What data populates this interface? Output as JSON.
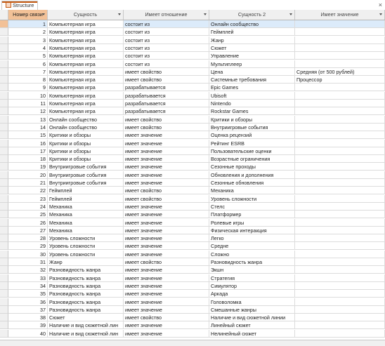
{
  "tab": {
    "title": "Structure",
    "close": "×"
  },
  "columns": [
    {
      "label": "Номер связи",
      "selected": true
    },
    {
      "label": "Сущность"
    },
    {
      "label": "Имеет отношение"
    },
    {
      "label": "Сущность 2"
    },
    {
      "label": "Имеет значение"
    }
  ],
  "rows": [
    [
      "1",
      "Компьютерная игра",
      "состоит из",
      "Онлайн сообщество",
      ""
    ],
    [
      "2",
      "Компьютерная игра",
      "состоит из",
      "Геймплей",
      ""
    ],
    [
      "3",
      "Компьютерная игра",
      "состоит из",
      "Жанр",
      ""
    ],
    [
      "4",
      "Компьютерная игра",
      "состоит из",
      "Сюжет",
      ""
    ],
    [
      "5",
      "Компьютерная игра",
      "состоит из",
      "Управление",
      ""
    ],
    [
      "6",
      "Компьютерная игра",
      "состоит из",
      "Мультиплеер",
      ""
    ],
    [
      "7",
      "Компьютерная игра",
      "имеет свойство",
      "Цена",
      "Средняя (от 500 рублей)"
    ],
    [
      "8",
      "Компьютерная игра",
      "имеет свойство",
      "Системные требования",
      "Процессор"
    ],
    [
      "9",
      "Компьютерная игра",
      "разрабатывается",
      "Epic Games",
      ""
    ],
    [
      "10",
      "Компьютерная игра",
      "разрабатывается",
      "Ubisoft",
      ""
    ],
    [
      "11",
      "Компьютерная игра",
      "разрабатывается",
      "Nintendo",
      ""
    ],
    [
      "12",
      "Компьютерная игра",
      "разрабатывается",
      "Rockstar Games",
      ""
    ],
    [
      "13",
      "Онлайн сообщество",
      "имеет свойство",
      "Критики и обзоры",
      ""
    ],
    [
      "14",
      "Онлайн сообщество",
      "имеет свойство",
      "Внутриигровые события",
      ""
    ],
    [
      "15",
      "Критики и обзоры",
      "имеет значение",
      "Оценка рецензий",
      ""
    ],
    [
      "16",
      "Критики и обзоры",
      "имеет значение",
      "Рейтинг ESRB",
      ""
    ],
    [
      "17",
      "Критики и обзоры",
      "имеет значение",
      "Пользовательские оценки",
      ""
    ],
    [
      "18",
      "Критики и обзоры",
      "имеет значение",
      "Возрастные ограничения",
      ""
    ],
    [
      "19",
      "Внутриигровые события",
      "имеет значение",
      "Сезонные проходы",
      ""
    ],
    [
      "20",
      "Внутриигровые события",
      "имеет значение",
      "Обновления и дополнения",
      ""
    ],
    [
      "21",
      "Внутриигровые события",
      "имеет значение",
      "Сезонные обновления",
      ""
    ],
    [
      "22",
      "Геймплей",
      "имеет свойство",
      "Механика",
      ""
    ],
    [
      "23",
      "Геймплей",
      "имеет свойство",
      "Уровень сложности",
      ""
    ],
    [
      "24",
      "Механика",
      "имеет значение",
      "Стелс",
      ""
    ],
    [
      "25",
      "Механика",
      "имеет значение",
      "Платформер",
      ""
    ],
    [
      "26",
      "Механика",
      "имеет значение",
      "Ролевые игры",
      ""
    ],
    [
      "27",
      "Механика",
      "имеет значение",
      "Физическая интеракция",
      ""
    ],
    [
      "28",
      "Уровень сложности",
      "имеет значение",
      "Легко",
      ""
    ],
    [
      "29",
      "Уровень сложности",
      "имеет значение",
      "Средне",
      ""
    ],
    [
      "30",
      "Уровень сложности",
      "имеет значение",
      "Сложно",
      ""
    ],
    [
      "31",
      "Жанр",
      "имеет свойство",
      "Разновидность жанра",
      ""
    ],
    [
      "32",
      "Разновидность жанра",
      "имеет значение",
      "Экшн",
      ""
    ],
    [
      "33",
      "Разновидность жанра",
      "имеет значение",
      "Стратегия",
      ""
    ],
    [
      "34",
      "Разновидность жанра",
      "имеет значение",
      "Симулятор",
      ""
    ],
    [
      "35",
      "Разновидность жанра",
      "имеет значение",
      "Аркада",
      ""
    ],
    [
      "36",
      "Разновидность жанра",
      "имеет значение",
      "Головоломка",
      ""
    ],
    [
      "37",
      "Разновидность жанра",
      "имеет значение",
      "Смешанные жанры",
      ""
    ],
    [
      "38",
      "Сюжет",
      "имеет свойство",
      "Наличие и вид сюжетной линии",
      ""
    ],
    [
      "39",
      "Наличие и вид сюжетной лин",
      "имеет значение",
      "Линейный сюжет",
      ""
    ],
    [
      "40",
      "Наличие и вид сюжетной лин",
      "имеет значение",
      "Нелинейный сюжет",
      ""
    ]
  ]
}
